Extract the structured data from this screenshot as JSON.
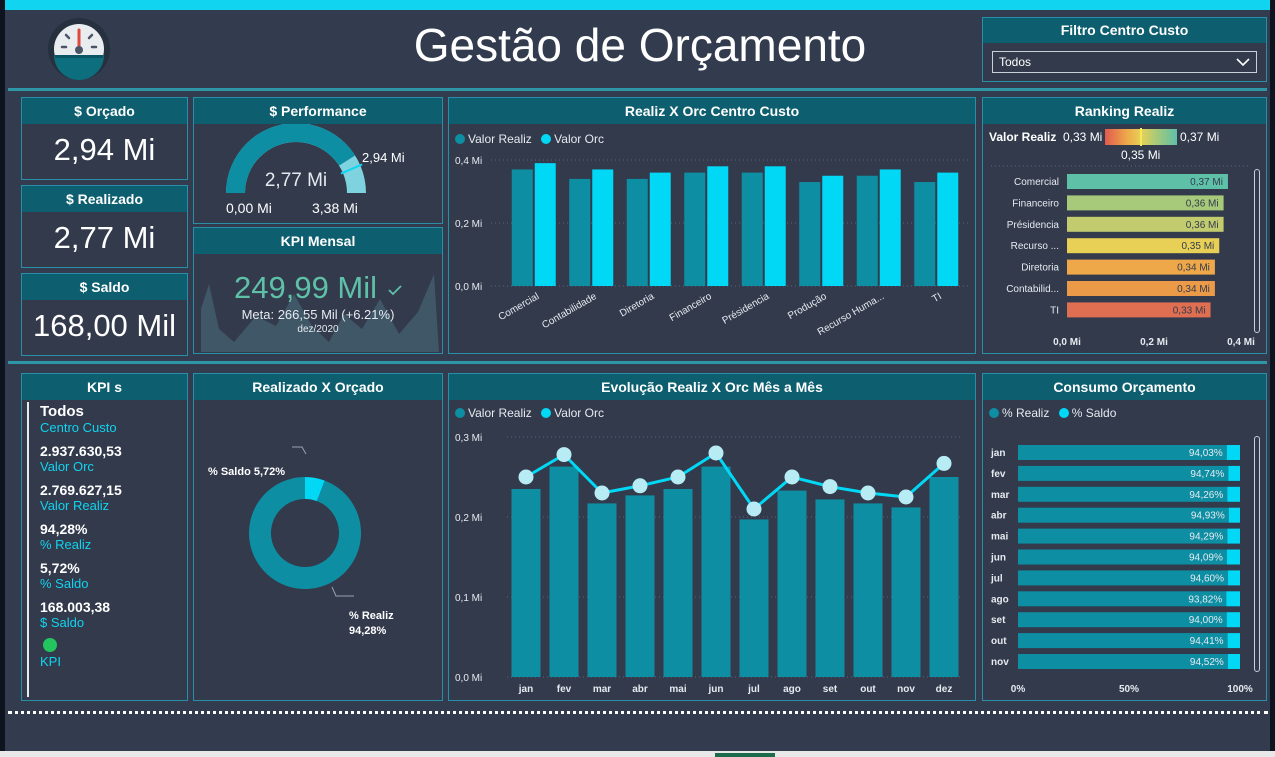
{
  "header": {
    "title": "Gestão de Orçamento"
  },
  "filter": {
    "title": "Filtro Centro Custo",
    "selected": "Todos"
  },
  "cards": {
    "orcado": {
      "title": "$ Orçado",
      "value": "2,94 Mi"
    },
    "realizado": {
      "title": "$ Realizado",
      "value": "2,77 Mi"
    },
    "saldo": {
      "title": "$ Saldo",
      "value": "168,00 Mil"
    }
  },
  "performance": {
    "title": "$ Performance",
    "value": "2,77 Mi",
    "target": "2,94 Mi",
    "min": "0,00 Mi",
    "max": "3,38 Mi",
    "fill_fraction": 0.82,
    "target_fraction": 0.87
  },
  "kpi_mensal": {
    "title": "KPI Mensal",
    "value": "249,99 Mil",
    "meta": "Meta: 266,55 Mil (+6.21%)",
    "period": "dez/2020"
  },
  "colors": {
    "valor_realiz": "#0e8ea3",
    "valor_orc": "#00d8f5",
    "background": "#333c4f",
    "title_bg": "#0d5f6f"
  },
  "realiz_x_orc_cc": {
    "title": "Realiz X Orc Centro Custo",
    "legend": [
      "Valor Realiz",
      "Valor Orc"
    ],
    "chart_data": {
      "type": "bar",
      "categories": [
        "Comercial",
        "Contabilidade",
        "Diretoria",
        "Financeiro",
        "Présidencia",
        "Produção",
        "Recurso Huma...",
        "TI"
      ],
      "series": [
        {
          "name": "Valor Realiz",
          "values": [
            0.37,
            0.34,
            0.34,
            0.36,
            0.36,
            0.33,
            0.35,
            0.33
          ]
        },
        {
          "name": "Valor Orc",
          "values": [
            0.39,
            0.37,
            0.36,
            0.38,
            0.38,
            0.35,
            0.37,
            0.36
          ]
        }
      ],
      "yticks": [
        "0,0 Mi",
        "0,2 Mi",
        "0,4 Mi"
      ],
      "ylim": [
        0,
        0.4
      ]
    }
  },
  "ranking": {
    "title": "Ranking Realiz",
    "legend_label": "Valor Realiz",
    "legend_min": "0,33 Mi",
    "legend_max": "0,37 Mi",
    "legend_mid": "0,35 Mi",
    "xticks": [
      "0,0 Mi",
      "0,2 Mi",
      "0,4 Mi"
    ],
    "chart_data": {
      "type": "bar",
      "orientation": "horizontal",
      "categories": [
        "Comercial",
        "Financeiro",
        "Présidencia",
        "Recurso ...",
        "Diretoria",
        "Contabilid...",
        "TI"
      ],
      "values": [
        0.37,
        0.36,
        0.36,
        0.35,
        0.34,
        0.34,
        0.33
      ],
      "labels": [
        "0,37 Mi",
        "0,36 Mi",
        "0,36 Mi",
        "0,35 Mi",
        "0,34 Mi",
        "0,34 Mi",
        "0,33 Mi"
      ],
      "colors": [
        "#5fc0a8",
        "#a6c97a",
        "#c2cc6e",
        "#e8d056",
        "#eea84a",
        "#eb9a48",
        "#e06e50"
      ],
      "xlim": [
        0,
        0.4
      ]
    }
  },
  "kpis": {
    "title": "KPI s",
    "items": [
      {
        "value": "Todos",
        "label": "Centro Custo"
      },
      {
        "value": "2.937.630,53",
        "label": "Valor Orc"
      },
      {
        "value": "2.769.627,15",
        "label": "Valor Realiz"
      },
      {
        "value": "94,28%",
        "label": "% Realiz"
      },
      {
        "value": "5,72%",
        "label": "% Saldo"
      },
      {
        "value": "168.003,38",
        "label": "$ Saldo"
      }
    ],
    "indicator_label": "KPI",
    "indicator_color": "#22c55e"
  },
  "realizado_x_orcado": {
    "title": "Realizado X Orçado",
    "chart_data": {
      "type": "pie",
      "donut": true,
      "labels": [
        "% Realiz",
        "% Saldo"
      ],
      "values": [
        94.28,
        5.72
      ],
      "display": [
        "94,28%",
        "5,72%"
      ],
      "colors": [
        "#0e8ea3",
        "#00d8f5"
      ]
    },
    "label_saldo": "% Saldo 5,72%",
    "label_realiz": "% Realiz",
    "label_realiz_value": "94,28%"
  },
  "evolucao": {
    "title": "Evolução Realiz X Orc Mês a Mês",
    "legend": [
      "Valor Realiz",
      "Valor Orc"
    ],
    "chart_data": {
      "type": "bar",
      "categories": [
        "jan",
        "fev",
        "mar",
        "abr",
        "mai",
        "jun",
        "jul",
        "ago",
        "set",
        "out",
        "nov",
        "dez"
      ],
      "series": [
        {
          "name": "Valor Realiz",
          "kind": "bar",
          "values": [
            0.235,
            0.263,
            0.217,
            0.227,
            0.235,
            0.263,
            0.197,
            0.233,
            0.222,
            0.217,
            0.212,
            0.25
          ]
        },
        {
          "name": "Valor Orc",
          "kind": "line",
          "values": [
            0.25,
            0.278,
            0.23,
            0.239,
            0.25,
            0.28,
            0.21,
            0.25,
            0.238,
            0.23,
            0.225,
            0.267
          ]
        }
      ],
      "yticks": [
        "0,0 Mi",
        "0,1 Mi",
        "0,2 Mi",
        "0,3 Mi"
      ],
      "ylim": [
        0,
        0.3
      ]
    }
  },
  "consumo": {
    "title": "Consumo Orçamento",
    "legend": [
      "% Realiz",
      "% Saldo"
    ],
    "xticks": [
      "0%",
      "50%",
      "100%"
    ],
    "chart_data": {
      "type": "bar",
      "orientation": "horizontal",
      "stacked": true,
      "categories": [
        "jan",
        "fev",
        "mar",
        "abr",
        "mai",
        "jun",
        "jul",
        "ago",
        "set",
        "out",
        "nov"
      ],
      "values": [
        94.03,
        94.74,
        94.26,
        94.93,
        94.29,
        94.09,
        94.6,
        93.82,
        94.0,
        94.41,
        94.52
      ],
      "labels": [
        "94,03%",
        "94,74%",
        "94,26%",
        "94,93%",
        "94,29%",
        "94,09%",
        "94,60%",
        "93,82%",
        "94,00%",
        "94,41%",
        "94,52%"
      ],
      "xlim": [
        0,
        100
      ]
    }
  }
}
